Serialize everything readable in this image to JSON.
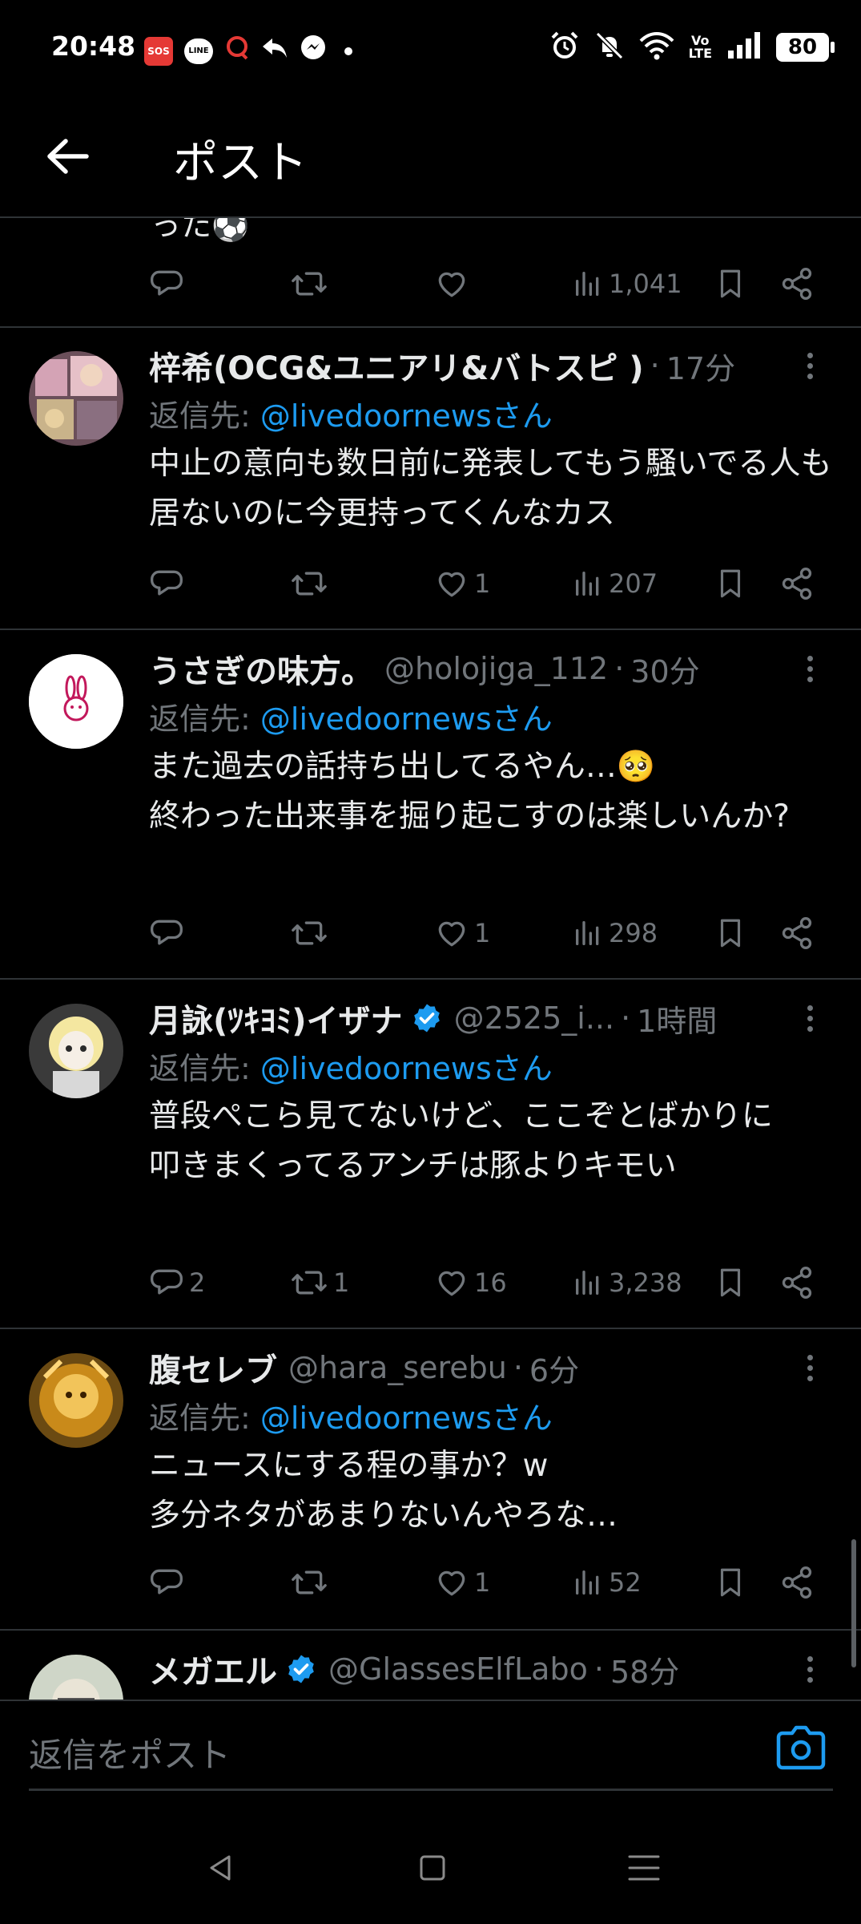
{
  "status_bar": {
    "time": "20:48",
    "sos": "SOS",
    "line": "LINE",
    "volte_top": "Vo",
    "volte_bottom": "LTE",
    "battery": "80"
  },
  "header": {
    "title": "ポスト"
  },
  "partial_tweet": {
    "text_fragment": "った⚽",
    "actions": {
      "reply": "",
      "repost": "",
      "like": "",
      "views": "1,041"
    }
  },
  "reply_prefix": "返信先: ",
  "tweets": [
    {
      "name": "梓希(OCG&ユニアリ&バトスピ )",
      "handle": "",
      "time": "17分",
      "verified": false,
      "reply_to": "@livedoornewsさん",
      "body": "中止の意向も数日前に発表してもう騒いでる人も居ないのに今更持ってくんなカス",
      "reply_count": "",
      "repost_count": "",
      "like_count": "1",
      "views": "207"
    },
    {
      "name": "うさぎの味方。",
      "handle": "@holojiga_112",
      "time": "30分",
      "verified": false,
      "reply_to": "@livedoornewsさん",
      "body": "また過去の話持ち出してるやん…🥺\n終わった出来事を掘り起こすのは楽しいんか?",
      "reply_count": "",
      "repost_count": "",
      "like_count": "1",
      "views": "298"
    },
    {
      "name": "月詠(ﾂｷﾖﾐ)イザナ",
      "handle": "@2525_i...",
      "time": "1時間",
      "verified": true,
      "reply_to": "@livedoornewsさん",
      "body": "普段ぺこら見てないけど、ここぞとばかりに\n叩きまくってるアンチは豚よりキモい",
      "reply_count": "2",
      "repost_count": "1",
      "like_count": "16",
      "views": "3,238"
    },
    {
      "name": "腹セレブ",
      "handle": "@hara_serebu",
      "time": "6分",
      "verified": false,
      "reply_to": "@livedoornewsさん",
      "body": "ニュースにする程の事か？w\n多分ネタがあまりないんやろな…",
      "reply_count": "",
      "repost_count": "",
      "like_count": "1",
      "views": "52"
    },
    {
      "name": "メガエル",
      "handle": "@GlassesElfLabo",
      "time": "58分",
      "verified": true
    }
  ],
  "reply_bar": {
    "placeholder": "返信をポスト"
  },
  "colors": {
    "background": "#000000",
    "text": "#e7e9ea",
    "muted": "#71767b",
    "accent": "#1d9bf0",
    "divider": "#2f3336"
  }
}
